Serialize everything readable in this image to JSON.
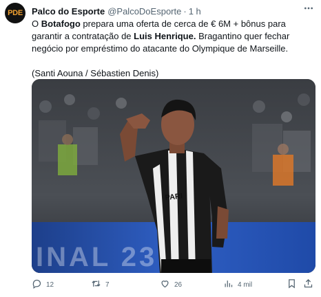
{
  "tweet": {
    "avatar_text": "PDE",
    "display_name": "Palco do Esporte",
    "handle": "@PalcoDoEsporte",
    "separator": "·",
    "time": "1 h",
    "body": {
      "t1": "O ",
      "t2": "Botafogo",
      "t3": " prepara uma oferta de cerca de € 6M + bônus para garantir a contratação de ",
      "t4": "Luis Henrique.",
      "t5": " Bragantino quer fechar negócio por empréstimo do atacante do Olympique de Marseille.",
      "credit": "(Santi Aouna / Sébastien Denis)"
    },
    "media": {
      "banner_text": "INAL 23",
      "jersey_sponsor": "PARI"
    },
    "actions": {
      "replies": "12",
      "retweets": "7",
      "likes": "26",
      "views": "4 mil"
    }
  },
  "colors": {
    "text": "#0f1419",
    "secondary": "#536471",
    "avatar_bg": "#111111",
    "avatar_fg": "#f0a030"
  },
  "icons": [
    "more-icon",
    "reply-icon",
    "retweet-icon",
    "like-icon",
    "views-icon",
    "bookmark-icon",
    "share-icon"
  ]
}
